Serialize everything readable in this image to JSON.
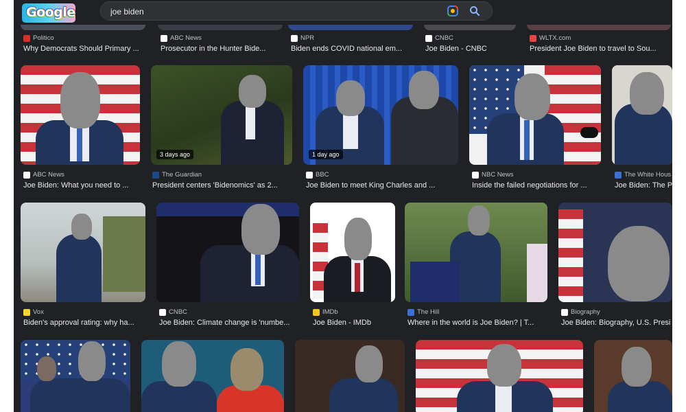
{
  "search": {
    "query": "joe biden",
    "logo_text": "Google"
  },
  "colors": {
    "page_bg": "#202124",
    "text": "#e8eaed",
    "meta_text": "#bdc1c6"
  },
  "row0": [
    {
      "source": "Politico",
      "title": "Why Democrats Should Primary ...",
      "favicon": "#d93025"
    },
    {
      "source": "ABC News",
      "title": "Prosecutor in the Hunter Bide...",
      "favicon": "#ffffff"
    },
    {
      "source": "NPR",
      "title": "Biden ends COVID national em...",
      "favicon": "#ffffff"
    },
    {
      "source": "CNBC",
      "title": "Joe Biden - CNBC",
      "favicon": "#ffffff"
    },
    {
      "source": "WLTX.com",
      "title": "President Joe Biden to travel to Sou...",
      "favicon": "#e84545"
    }
  ],
  "row1": [
    {
      "source": "ABC News",
      "title": "Joe Biden: What you need to ...",
      "favicon": "#ffffff",
      "badge": ""
    },
    {
      "source": "The Guardian",
      "title": "President centers 'Bidenomics' as 2...",
      "favicon": "#1a4b8c",
      "badge": "3 days ago"
    },
    {
      "source": "BBC",
      "title": "Joe Biden to meet King Charles and ...",
      "favicon": "#ffffff",
      "badge": "1 day ago"
    },
    {
      "source": "NBC News",
      "title": "Inside the failed negotiations for ...",
      "favicon": "#ffffff",
      "badge": ""
    },
    {
      "source": "The White Hous",
      "title": "Joe Biden: The P",
      "favicon": "#3b6fd4",
      "badge": ""
    }
  ],
  "row2": [
    {
      "source": "Vox",
      "title": "Biden's approval rating: why ha...",
      "favicon": "#f6d32d"
    },
    {
      "source": "CNBC",
      "title": "Joe Biden: Climate change is 'numbe...",
      "favicon": "#ffffff"
    },
    {
      "source": "IMDb",
      "title": "Joe Biden - IMDb",
      "favicon": "#f5c518"
    },
    {
      "source": "The Hill",
      "title": "Where in the world is Joe Biden? | T...",
      "favicon": "#3b6fd4"
    },
    {
      "source": "Biography",
      "title": "Joe Biden: Biography, U.S. Presi",
      "favicon": "#ffffff"
    }
  ]
}
